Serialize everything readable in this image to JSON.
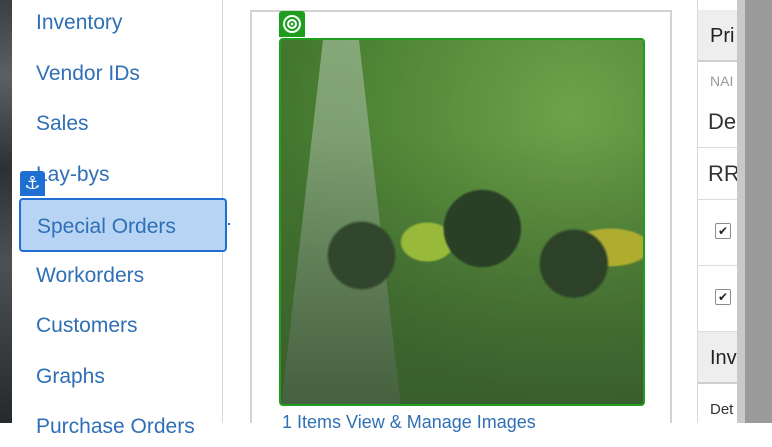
{
  "sidebar": {
    "items": [
      {
        "label": "Inventory"
      },
      {
        "label": "Vendor IDs"
      },
      {
        "label": "Sales"
      },
      {
        "label": "Lay-bys"
      },
      {
        "label": "Special Orders",
        "selected": true
      },
      {
        "label": "Workorders"
      },
      {
        "label": "Customers"
      },
      {
        "label": "Graphs"
      },
      {
        "label": "Purchase Orders"
      }
    ]
  },
  "annotations": {
    "anchor_icon": "anchor-icon",
    "target_icon": "target-icon",
    "anchor_color": "#1e6fd1",
    "target_color": "#1f9d1f"
  },
  "main": {
    "caption": "1 Items      View & Manage Images"
  },
  "right_panel": {
    "header1": "Pri",
    "name_label": "NAI",
    "row_de": "De",
    "row_rr": "RR",
    "check1": "✔",
    "check2": "✔",
    "header2": "Inv",
    "row_det": "Det"
  }
}
